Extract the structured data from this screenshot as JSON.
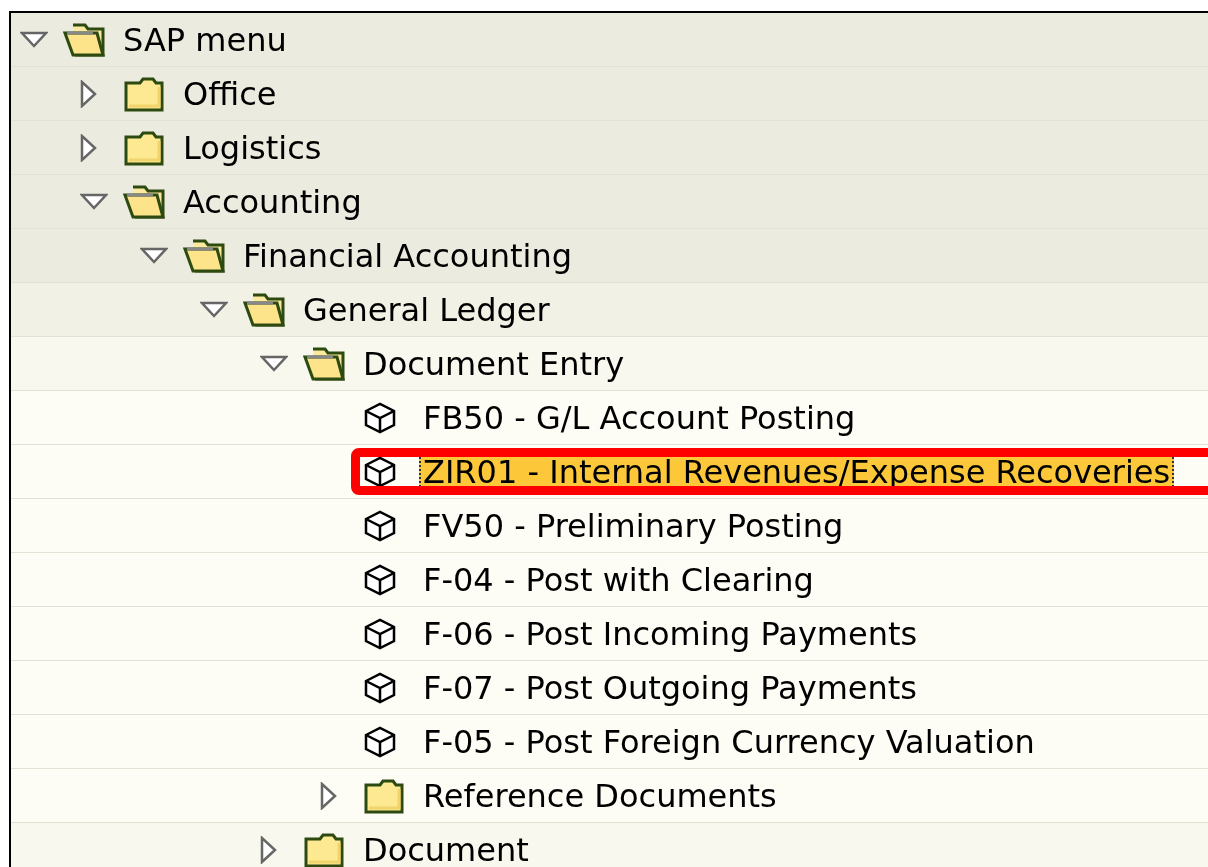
{
  "tree": [
    {
      "kind": "folder",
      "label": "SAP menu",
      "expanded": true,
      "selected": false,
      "marked": false,
      "children": [
        {
          "kind": "folder",
          "label": "Office",
          "expanded": false,
          "selected": false,
          "marked": false
        },
        {
          "kind": "folder",
          "label": "Logistics",
          "expanded": false,
          "selected": false,
          "marked": false
        },
        {
          "kind": "folder",
          "label": "Accounting",
          "expanded": true,
          "selected": false,
          "marked": false,
          "children": [
            {
              "kind": "folder",
              "label": "Financial Accounting",
              "expanded": true,
              "selected": false,
              "marked": false,
              "children": [
                {
                  "kind": "folder",
                  "label": "General Ledger",
                  "expanded": true,
                  "selected": false,
                  "marked": false,
                  "children": [
                    {
                      "kind": "folder",
                      "label": "Document Entry",
                      "expanded": true,
                      "selected": false,
                      "marked": false,
                      "children": [
                        {
                          "kind": "transaction",
                          "label": "FB50 - G/L Account Posting",
                          "selected": false,
                          "marked": false
                        },
                        {
                          "kind": "transaction",
                          "label": "ZIR01 - Internal Revenues/Expense Recoveries",
                          "selected": true,
                          "marked": true
                        },
                        {
                          "kind": "transaction",
                          "label": "FV50 - Preliminary Posting",
                          "selected": false,
                          "marked": false
                        },
                        {
                          "kind": "transaction",
                          "label": "F-04 - Post with Clearing",
                          "selected": false,
                          "marked": false
                        },
                        {
                          "kind": "transaction",
                          "label": "F-06 - Post Incoming Payments",
                          "selected": false,
                          "marked": false
                        },
                        {
                          "kind": "transaction",
                          "label": "F-07 - Post Outgoing Payments",
                          "selected": false,
                          "marked": false
                        },
                        {
                          "kind": "transaction",
                          "label": "F-05 - Post Foreign Currency Valuation",
                          "selected": false,
                          "marked": false
                        },
                        {
                          "kind": "folder",
                          "label": "Reference Documents",
                          "expanded": false,
                          "selected": false,
                          "marked": false
                        }
                      ]
                    },
                    {
                      "kind": "folder",
                      "label": "Document",
                      "expanded": false,
                      "selected": false,
                      "marked": false
                    }
                  ]
                }
              ]
            }
          ]
        }
      ]
    }
  ]
}
